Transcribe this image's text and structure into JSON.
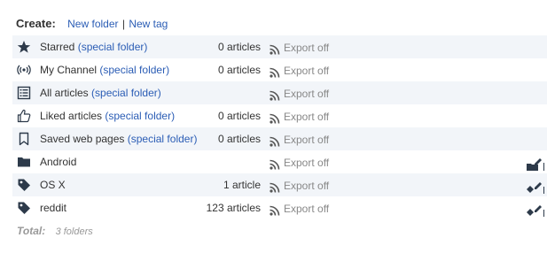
{
  "create": {
    "label": "Create:",
    "new_folder": "New folder",
    "separator": "|",
    "new_tag": "New tag"
  },
  "rows": [
    {
      "icon": "star-icon",
      "name": "Starred",
      "special": "(special folder)",
      "count": "0 articles",
      "export": "Export off"
    },
    {
      "icon": "broadcast-icon",
      "name": "My Channel",
      "special": "(special folder)",
      "count": "0 articles",
      "export": "Export off"
    },
    {
      "icon": "list-icon",
      "name": "All articles",
      "special": "(special folder)",
      "count": "",
      "export": "Export off"
    },
    {
      "icon": "thumbs-up-icon",
      "name": "Liked articles",
      "special": "(special folder)",
      "count": "0 articles",
      "export": "Export off"
    },
    {
      "icon": "bookmark-icon",
      "name": "Saved web pages",
      "special": "(special folder)",
      "count": "0 articles",
      "export": "Export off"
    },
    {
      "icon": "folder-icon",
      "name": "Android",
      "special": "",
      "count": "",
      "export": "Export off"
    },
    {
      "icon": "tag-icon",
      "name": "OS X",
      "special": "",
      "count": "1 article",
      "export": "Export off"
    },
    {
      "icon": "tag-icon",
      "name": "reddit",
      "special": "",
      "count": "123 articles",
      "export": "Export off"
    }
  ],
  "total": {
    "label": "Total:",
    "value": "3 folders"
  },
  "colors": {
    "link": "#2b5db5",
    "stripe": "#f2f5f9",
    "muted": "#888888",
    "icon": "#2d3a4a"
  }
}
